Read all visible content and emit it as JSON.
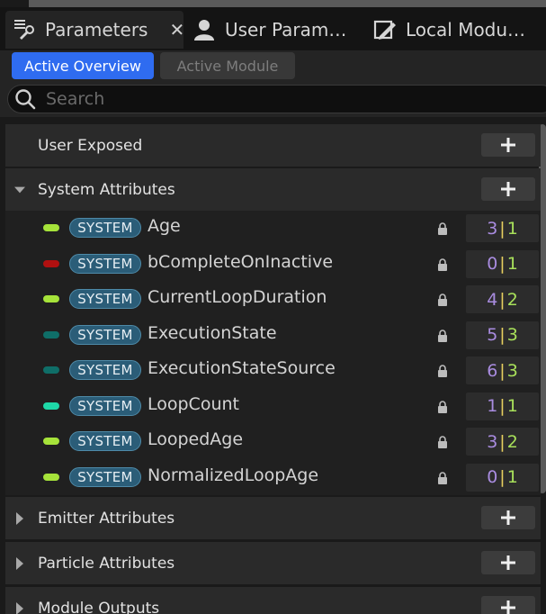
{
  "tabs": [
    {
      "label": "Parameters",
      "icon": "parameters-list-icon",
      "active": true,
      "close": "✕"
    },
    {
      "label": "User Param…",
      "icon": "user-icon",
      "active": false
    },
    {
      "label": "Local Modu…",
      "icon": "local-module-icon",
      "active": false
    }
  ],
  "view_toggle": {
    "active_overview": "Active Overview",
    "active_module": "Active Module",
    "selected": "Active Overview"
  },
  "search": {
    "placeholder": "Search",
    "value": ""
  },
  "categories": {
    "user_exposed": {
      "label": "User Exposed"
    },
    "system_attributes": {
      "label": "System Attributes",
      "expanded": true
    },
    "emitter_attributes": {
      "label": "Emitter Attributes",
      "expanded": false
    },
    "particle_attributes": {
      "label": "Particle Attributes",
      "expanded": false
    },
    "module_outputs": {
      "label": "Module Outputs",
      "expanded": false
    }
  },
  "system_params": [
    {
      "badge": "SYSTEM",
      "name": "Age",
      "color": "#a6e33a",
      "reads": "3",
      "writes": "1"
    },
    {
      "badge": "SYSTEM",
      "name": "bCompleteOnInactive",
      "color": "#b01010",
      "reads": "0",
      "writes": "1"
    },
    {
      "badge": "SYSTEM",
      "name": "CurrentLoopDuration",
      "color": "#a6e33a",
      "reads": "4",
      "writes": "2"
    },
    {
      "badge": "SYSTEM",
      "name": "ExecutionState",
      "color": "#0f6e68",
      "reads": "5",
      "writes": "3"
    },
    {
      "badge": "SYSTEM",
      "name": "ExecutionStateSource",
      "color": "#0f6e68",
      "reads": "6",
      "writes": "3"
    },
    {
      "badge": "SYSTEM",
      "name": "LoopCount",
      "color": "#1ed8a8",
      "reads": "1",
      "writes": "1"
    },
    {
      "badge": "SYSTEM",
      "name": "LoopedAge",
      "color": "#a6e33a",
      "reads": "3",
      "writes": "2"
    },
    {
      "badge": "SYSTEM",
      "name": "NormalizedLoopAge",
      "color": "#a6e33a",
      "reads": "0",
      "writes": "1"
    }
  ],
  "colors": {
    "accent": "#2f6cf0",
    "badge_bg": "#2b5d78",
    "reads": "#a98ce0",
    "writes": "#a8e05a",
    "separator": "#e8d060"
  }
}
